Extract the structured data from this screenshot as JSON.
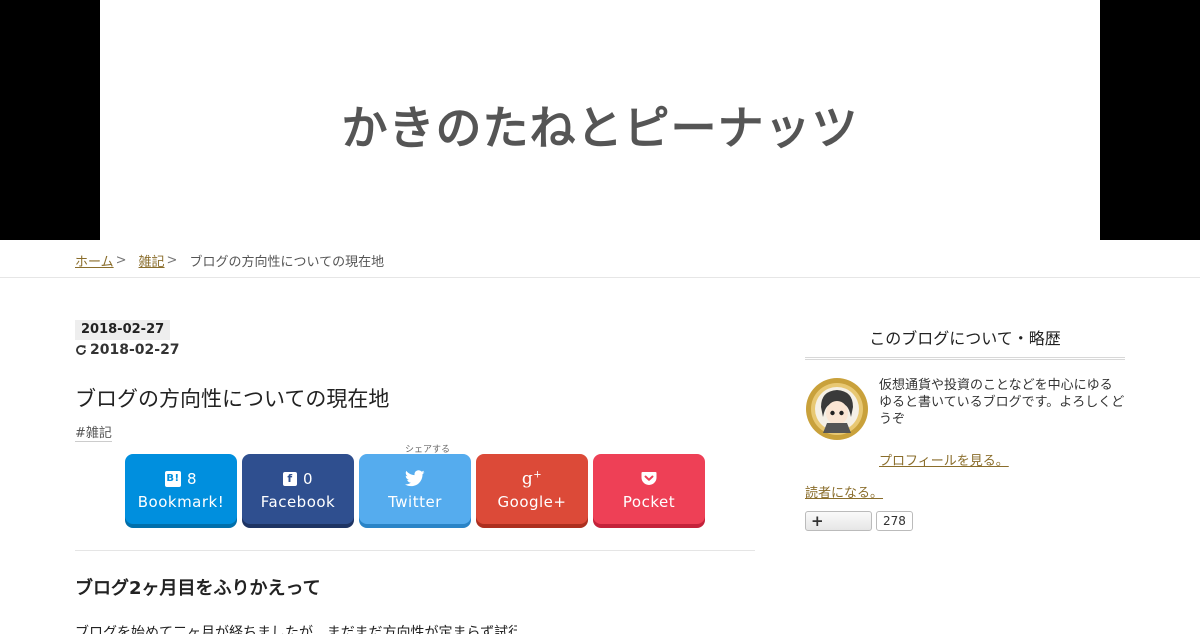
{
  "header": {
    "site_title": "かきのたねとピーナッツ"
  },
  "breadcrumb": {
    "home": "ホーム",
    "category": "雑記",
    "current": "ブログの方向性についての現在地",
    "separator": ">"
  },
  "post": {
    "date_posted": "2018-02-27",
    "date_updated": "2018-02-27",
    "title": "ブログの方向性についての現在地",
    "tag": "#雑記",
    "share_label": "シェアする",
    "share_buttons": [
      {
        "label": "Bookmark!",
        "count": "8",
        "icon": "hatena-icon",
        "color": "#008fde"
      },
      {
        "label": "Facebook",
        "count": "0",
        "icon": "facebook-icon",
        "color": "#2f4f8f"
      },
      {
        "label": "Twitter",
        "icon": "twitter-icon",
        "color": "#55acee"
      },
      {
        "label": "Google+",
        "icon": "google-plus-icon",
        "color": "#dc4a38"
      },
      {
        "label": "Pocket",
        "icon": "pocket-icon",
        "color": "#ee4056"
      }
    ],
    "section_heading": "ブログ2ヶ月目をふりかえって",
    "body_text": "ブログを始めて二ヶ月が経ちましたが、まだまだ方向性が定まらず試行錯誤しています"
  },
  "sidebar": {
    "title": "このブログについて・略歴",
    "profile_text": "仮想通貨や投資のことなどを中心にゆるゆると書いているブログです。よろしくどうぞ",
    "profile_link": "プロフィールを見る。",
    "follow_link": "読者になる。",
    "follow_button_symbol": "+",
    "follow_count": "278"
  },
  "colors": {
    "link": "#8a6d2b",
    "header_bg": "#000000",
    "logo": "#555555"
  }
}
